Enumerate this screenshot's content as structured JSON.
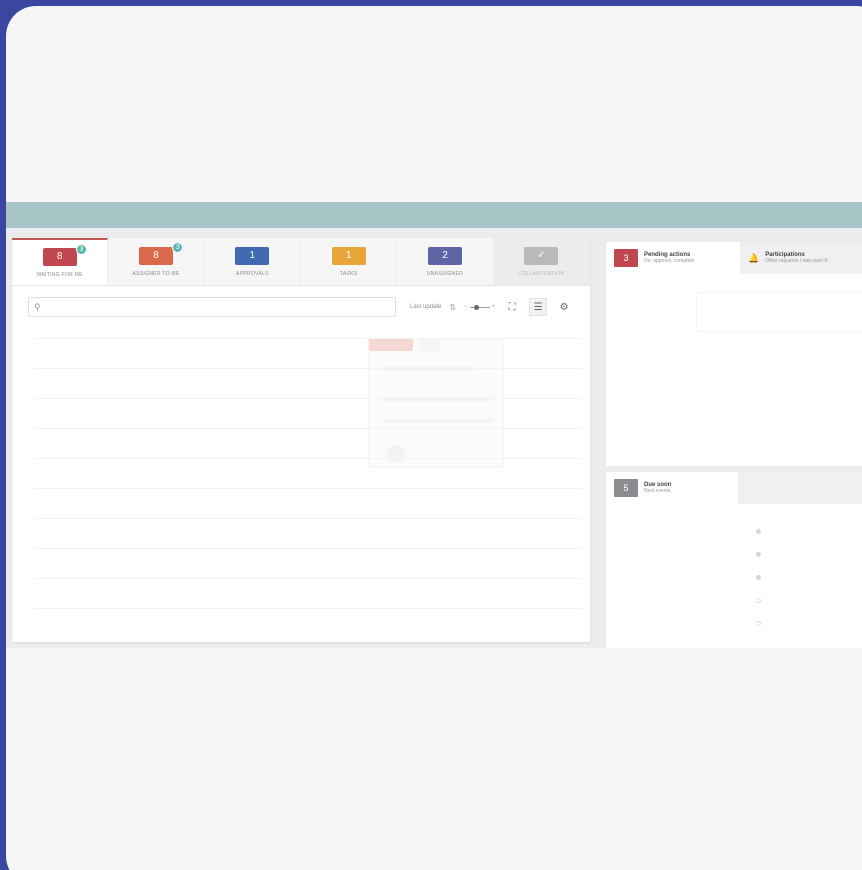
{
  "colors": {
    "background": "#3a46a0",
    "topbar": "#a7c5c6",
    "waiting": "#c0464f",
    "assigned": "#d9694a",
    "approvals": "#3f69b1",
    "tasks": "#e8a53a",
    "unassigned": "#5f64a6",
    "collab": "#b9b9bc",
    "badge": "#5ab4b0"
  },
  "tabs": [
    {
      "count": "8",
      "badge": "3",
      "label": "WAITING FOR ME",
      "color": "#c0464f"
    },
    {
      "count": "8",
      "badge": "3",
      "label": "ASSIGNED TO ME",
      "color": "#d9694a"
    },
    {
      "count": "1",
      "label": "APPROVALS",
      "color": "#3f69b1"
    },
    {
      "count": "1",
      "label": "TASKS",
      "color": "#e8a53a"
    },
    {
      "count": "2",
      "label": "UNASSIGNED",
      "color": "#5f64a6"
    },
    {
      "count": "✓",
      "label": "COLLABORATION",
      "color": "#b9b9bc"
    }
  ],
  "toolbar": {
    "search_placeholder": "",
    "last_update": "Last update",
    "icons": [
      "sort-icon",
      "zoom-slider",
      "fullscreen-icon",
      "list-view-icon",
      "settings-icon"
    ]
  },
  "pending": {
    "count": "3",
    "title": "Pending actions",
    "subtitle": "Do, approve, complete"
  },
  "participations": {
    "title": "Participations",
    "subtitle": "Other requests I take part of"
  },
  "due_soon": {
    "count": "5",
    "title": "Due soon",
    "subtitle": "Next events"
  }
}
